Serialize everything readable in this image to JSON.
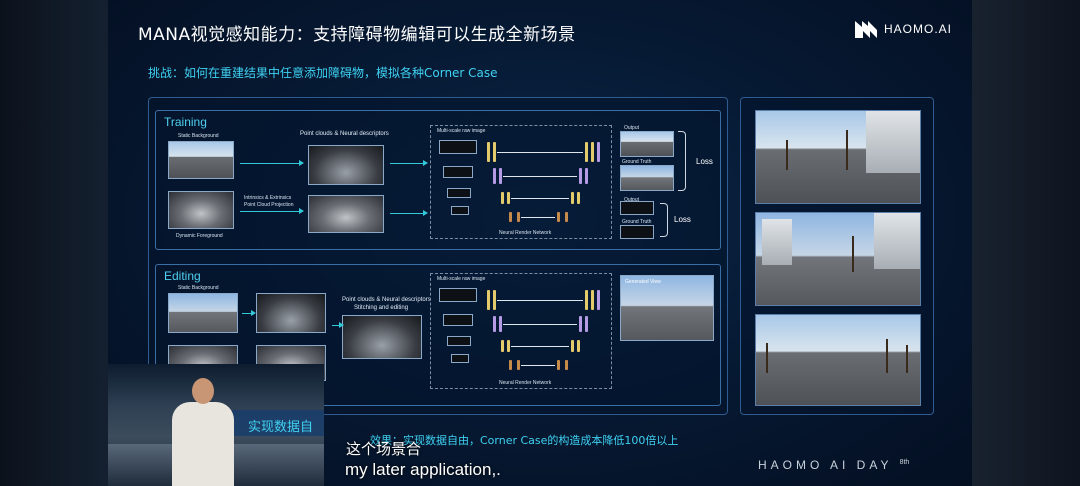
{
  "slide": {
    "title": "MANA视觉感知能力：支持障碍物编辑可以生成全新场景",
    "logo_text": "HAOMO.AI",
    "challenge": "挑战：如何在重建结果中任意添加障碍物，模拟各种Corner Case",
    "result": "效果：实现数据自由，Corner Case的构造成本降低100倍以上",
    "footer_brand": "HAOMO AI DAY",
    "footer_edition": "8th"
  },
  "training": {
    "label": "Training",
    "static_bg": "Static Background",
    "dynamic_fg": "Dynamic Foreground",
    "pc_label": "Point clouds & Neural descriptors",
    "intrinsics": "Intrinsics & Extrinsics",
    "projection": "Point Cloud Projection",
    "multiscale": "Multi-scale raw image",
    "network": "Neural Render Network",
    "output": "Output",
    "ground_truth": "Ground Truth",
    "loss": "Loss"
  },
  "editing": {
    "label": "Editing",
    "static_bg": "Static Background",
    "pc_label": "Point clouds & Neural descriptors",
    "stitching": "Stitching and editing",
    "multiscale": "Multi-scale raw image",
    "network": "Neural Render Network",
    "generated": "Generated View"
  },
  "pip": {
    "overlay": "实现数据自"
  },
  "subtitle": {
    "cn": "这个场景合",
    "en": "my later application,."
  },
  "colors": {
    "accent": "#3fd1f2",
    "panel_border": "#2e5c91",
    "yellow_block": "#e3cb6b",
    "purple_block": "#b59be6",
    "orange_block": "#c68a4a"
  }
}
